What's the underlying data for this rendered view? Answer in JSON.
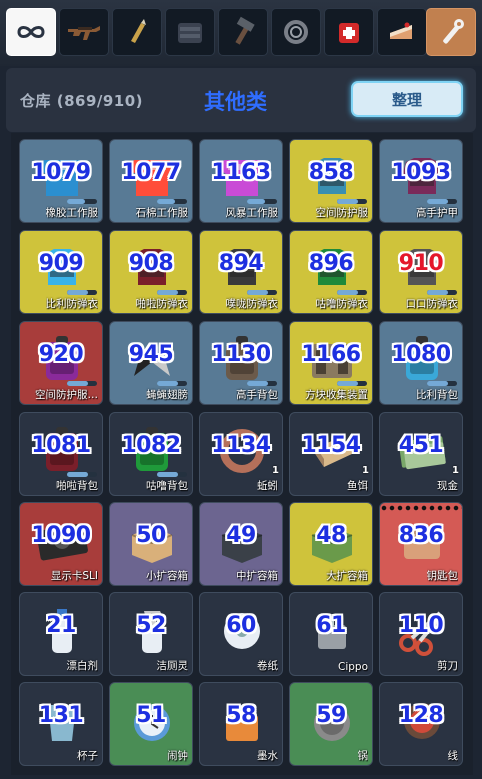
{
  "tabs": [
    {
      "icon": "infinity-icon",
      "selected": true
    },
    {
      "icon": "rifle-icon"
    },
    {
      "icon": "bullet-icon"
    },
    {
      "icon": "vest-icon"
    },
    {
      "icon": "hammer-icon"
    },
    {
      "icon": "rope-icon"
    },
    {
      "icon": "medkit-icon"
    },
    {
      "icon": "cake-icon"
    },
    {
      "icon": "wrench-icon",
      "active_color": "#c1804f"
    }
  ],
  "header": {
    "storage_label": "仓库 (869/910)",
    "category_title": "其他类",
    "sort_button": "整理"
  },
  "items": [
    {
      "count": "1079",
      "name": "橡胶工作服",
      "bg": "blue",
      "icon": "work-vest-icon",
      "color": "#2b8fd0",
      "bar": 0.6
    },
    {
      "count": "1077",
      "name": "石棉工作服",
      "bg": "blue",
      "icon": "work-vest-icon",
      "color": "#ff4d3a",
      "bar": 0.6
    },
    {
      "count": "1163",
      "name": "风暴工作服",
      "bg": "blue",
      "icon": "work-vest-icon",
      "color": "#c94bd6",
      "bar": 0.6
    },
    {
      "count": "858",
      "name": "空间防护服",
      "bg": "yellow",
      "icon": "armor-vest-icon",
      "color": "#3a8fb0",
      "bar": 0.7
    },
    {
      "count": "1093",
      "name": "高手护甲",
      "bg": "blue",
      "icon": "armor-vest-icon",
      "color": "#7a2a5a",
      "bar": 0.7
    },
    {
      "count": "909",
      "name": "比利防弹衣",
      "bg": "yellow",
      "icon": "armor-vest-icon",
      "color": "#3ab3e8",
      "bar": 0.7
    },
    {
      "count": "908",
      "name": "啪啦防弹衣",
      "bg": "yellow",
      "icon": "armor-vest-icon",
      "color": "#7a1f2a",
      "bar": 0.7
    },
    {
      "count": "894",
      "name": "噗咙防弹衣",
      "bg": "yellow",
      "icon": "armor-vest-icon",
      "color": "#3a3a3a",
      "bar": 0.7
    },
    {
      "count": "896",
      "name": "咕噜防弹衣",
      "bg": "yellow",
      "icon": "armor-vest-icon",
      "color": "#1f8a3a",
      "bar": 0.7
    },
    {
      "count": "910",
      "name": "口口防弹衣",
      "bg": "yellow",
      "icon": "armor-vest-icon",
      "color": "#555555",
      "bar": 0.7,
      "red": true
    },
    {
      "count": "920",
      "name": "空间防护服…",
      "bg": "red",
      "icon": "backpack-icon",
      "color": "#8a2a9a",
      "bar": 0.7
    },
    {
      "count": "945",
      "name": "蝇蝇翅膀",
      "bg": "blue",
      "icon": "wings-icon",
      "color": "#222222",
      "bar": 0.7
    },
    {
      "count": "1130",
      "name": "高手背包",
      "bg": "blue",
      "icon": "backpack-icon",
      "color": "#6b5a4a",
      "bar": 0.7
    },
    {
      "count": "1166",
      "name": "方块收集装置",
      "bg": "yellow",
      "icon": "crate-pack-icon",
      "color": "#8a7a60",
      "bar": 0.7
    },
    {
      "count": "1080",
      "name": "比利背包",
      "bg": "blue",
      "icon": "backpack-icon",
      "color": "#3aa8d8",
      "bar": 0.7
    },
    {
      "count": "1081",
      "name": "啪啦背包",
      "bg": "dark",
      "icon": "backpack-icon",
      "color": "#7a1f2a",
      "bar": 0.7
    },
    {
      "count": "1082",
      "name": "咕噜背包",
      "bg": "dark",
      "icon": "backpack-icon",
      "color": "#1f9a3a",
      "bar": 0.7
    },
    {
      "count": "1134",
      "name": "蚯蚓",
      "bg": "dark",
      "icon": "worm-icon",
      "color": "#b5705a",
      "stack": "1"
    },
    {
      "count": "1154",
      "name": "鱼饵",
      "bg": "dark",
      "icon": "bait-box-icon",
      "color": "#d9b98a",
      "stack": "1"
    },
    {
      "count": "451",
      "name": "现金",
      "bg": "dark",
      "icon": "cash-icon",
      "color": "#7aa86a",
      "stack": "1"
    },
    {
      "count": "1090",
      "name": "显示卡SLI",
      "bg": "red",
      "icon": "gpu-icon",
      "color": "#2a2a2a"
    },
    {
      "count": "50",
      "name": "小扩容箱",
      "bg": "purple",
      "icon": "box-icon",
      "color": "#d9b07a"
    },
    {
      "count": "49",
      "name": "中扩容箱",
      "bg": "purple",
      "icon": "box-icon",
      "color": "#3a4048"
    },
    {
      "count": "48",
      "name": "大扩容箱",
      "bg": "yellow",
      "icon": "box-icon",
      "color": "#6a9a4a"
    },
    {
      "count": "836",
      "name": "钥匙包",
      "bg": "salmon",
      "icon": "key-pouch-icon",
      "color": "#d9a07a",
      "dots": true
    },
    {
      "count": "21",
      "name": "漂白剂",
      "bg": "dark",
      "icon": "bottle-icon",
      "color": "#e8eef4"
    },
    {
      "count": "52",
      "name": "洁厕灵",
      "bg": "dark",
      "icon": "spray-bottle-icon",
      "color": "#e8eef4"
    },
    {
      "count": "60",
      "name": "卷纸",
      "bg": "dark",
      "icon": "toilet-paper-icon",
      "color": "#e8eef4"
    },
    {
      "count": "61",
      "name": "Cippo",
      "bg": "dark",
      "icon": "lighter-icon",
      "color": "#9aa0a6"
    },
    {
      "count": "110",
      "name": "剪刀",
      "bg": "dark",
      "icon": "scissors-icon",
      "color": "#d0503a"
    },
    {
      "count": "131",
      "name": "杯子",
      "bg": "dark",
      "icon": "cup-icon",
      "color": "#9ad0e8"
    },
    {
      "count": "51",
      "name": "闹钟",
      "bg": "green",
      "icon": "alarm-clock-icon",
      "color": "#5a9ad8"
    },
    {
      "count": "58",
      "name": "墨水",
      "bg": "dark",
      "icon": "ink-icon",
      "color": "#e88a3a"
    },
    {
      "count": "59",
      "name": "锅",
      "bg": "green",
      "icon": "pot-icon",
      "color": "#8a8a8a"
    },
    {
      "count": "128",
      "name": "线",
      "bg": "dark",
      "icon": "thread-spool-icon",
      "color": "#d04a3a"
    }
  ]
}
